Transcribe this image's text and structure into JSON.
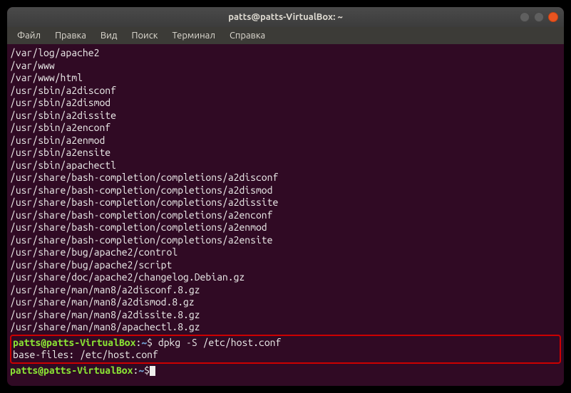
{
  "window": {
    "title": "patts@patts-VirtualBox: ~"
  },
  "menu": {
    "file": "Файл",
    "edit": "Правка",
    "view": "Вид",
    "search": "Поиск",
    "terminal": "Терминал",
    "help": "Справка"
  },
  "output": {
    "lines": [
      "/var/log/apache2",
      "/var/www",
      "/var/www/html",
      "/usr/sbin/a2disconf",
      "/usr/sbin/a2dismod",
      "/usr/sbin/a2dissite",
      "/usr/sbin/a2enconf",
      "/usr/sbin/a2enmod",
      "/usr/sbin/a2ensite",
      "/usr/sbin/apachectl",
      "/usr/share/bash-completion/completions/a2disconf",
      "/usr/share/bash-completion/completions/a2dismod",
      "/usr/share/bash-completion/completions/a2dissite",
      "/usr/share/bash-completion/completions/a2enconf",
      "/usr/share/bash-completion/completions/a2enmod",
      "/usr/share/bash-completion/completions/a2ensite",
      "/usr/share/bug/apache2/control",
      "/usr/share/bug/apache2/script",
      "/usr/share/doc/apache2/changelog.Debian.gz",
      "/usr/share/man/man8/a2disconf.8.gz",
      "/usr/share/man/man8/a2dismod.8.gz",
      "/usr/share/man/man8/a2dissite.8.gz",
      "/usr/share/man/man8/apachectl.8.gz"
    ]
  },
  "prompt1": {
    "user_host": "patts@patts-VirtualBox",
    "sep": ":",
    "path": "~",
    "dollar": "$",
    "command": " dpkg -S /etc/host.conf"
  },
  "result1": "base-files: /etc/host.conf",
  "prompt2": {
    "user_host": "patts@patts-VirtualBox",
    "sep": ":",
    "path": "~",
    "dollar": "$"
  }
}
